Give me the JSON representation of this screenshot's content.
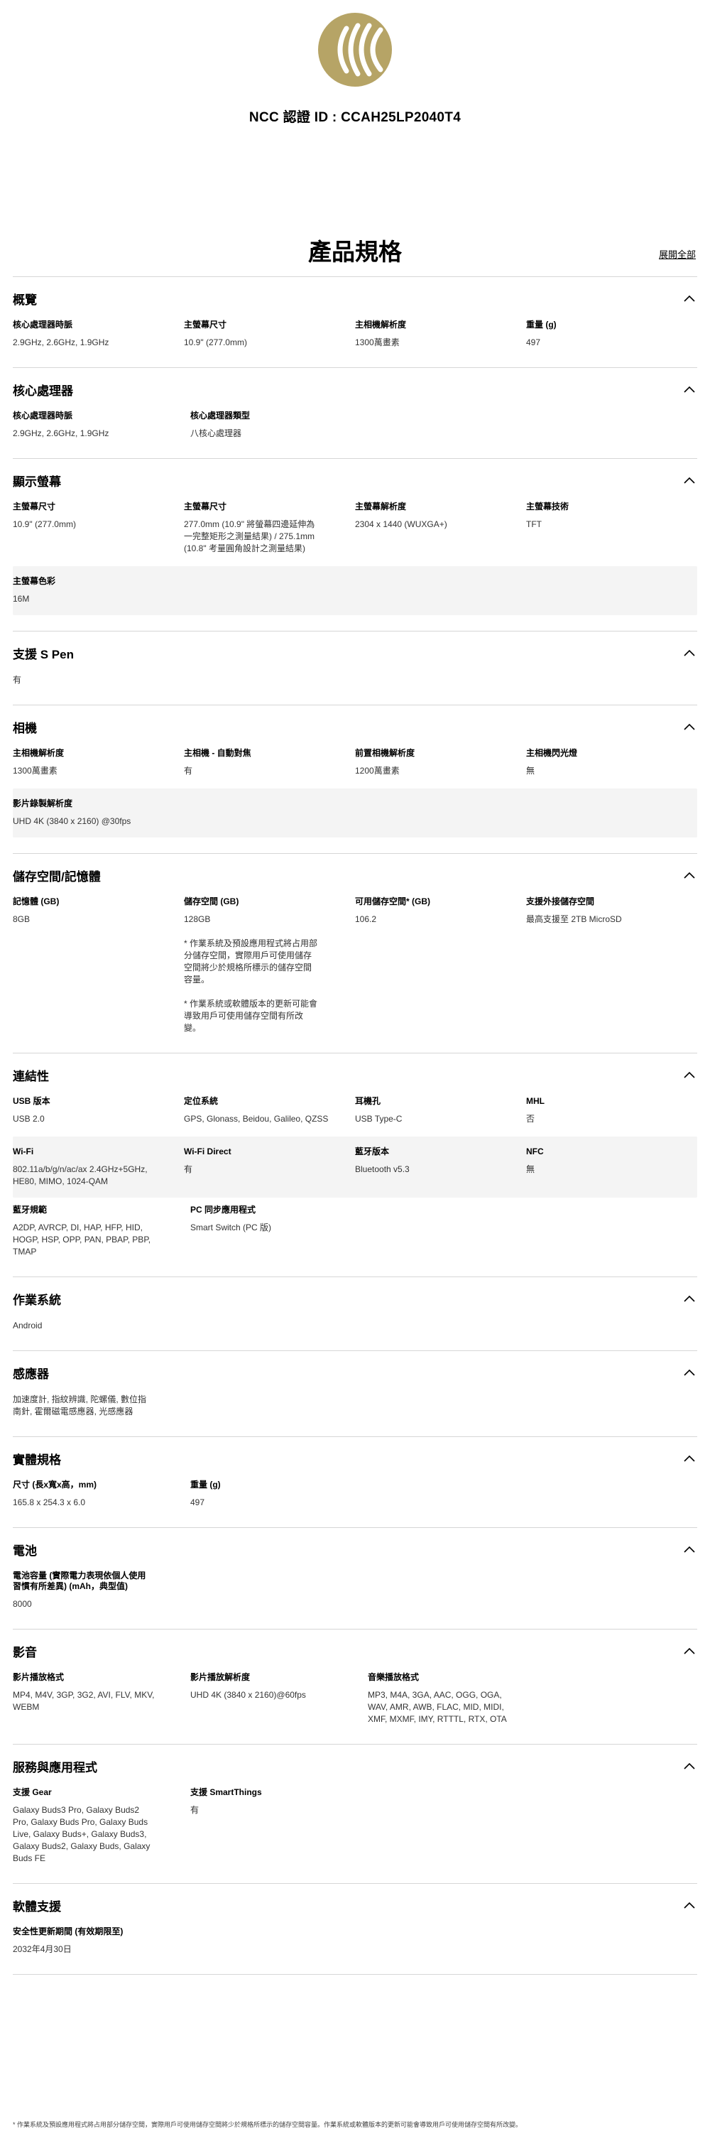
{
  "ncc": {
    "text": "NCC 認證 ID : CCAH25LP2040T4",
    "logo_color": "#B6A466"
  },
  "header": {
    "title": "產品規格",
    "expand_all": "展開全部"
  },
  "sections": [
    {
      "title": "概覽",
      "rows": [
        {
          "shaded": false,
          "cells": [
            {
              "label": "核心處理器時脈",
              "value": "2.9GHz, 2.6GHz, 1.9GHz"
            },
            {
              "label": "主螢幕尺寸",
              "value": "10.9\" (277.0mm)"
            },
            {
              "label": "主相機解析度",
              "value": "1300萬畫素"
            },
            {
              "label": "重量 (g)",
              "value": "497"
            }
          ]
        }
      ]
    },
    {
      "title": "核心處理器",
      "rows": [
        {
          "shaded": false,
          "cells": [
            {
              "label": "核心處理器時脈",
              "value": "2.9GHz, 2.6GHz, 1.9GHz"
            },
            {
              "label": "核心處理器類型",
              "value": "八核心處理器"
            }
          ]
        }
      ]
    },
    {
      "title": "顯示螢幕",
      "rows": [
        {
          "shaded": false,
          "cells": [
            {
              "label": "主螢幕尺寸",
              "value": "10.9\" (277.0mm)"
            },
            {
              "label": "主螢幕尺寸",
              "value": "277.0mm (10.9\" 將螢幕四邊延伸為\n一完整矩形之測量結果) / 275.1mm\n(10.8\" 考量圓角設計之測量結果)"
            },
            {
              "label": "主螢幕解析度",
              "value": "2304 x 1440 (WUXGA+)"
            },
            {
              "label": "主螢幕技術",
              "value": "TFT"
            }
          ]
        },
        {
          "shaded": true,
          "cells": [
            {
              "label": "主螢幕色彩",
              "value": "16M"
            }
          ]
        }
      ]
    },
    {
      "title": "支援 S Pen",
      "rows": [
        {
          "shaded": false,
          "cells": [
            {
              "label": "",
              "value": "有"
            }
          ]
        }
      ]
    },
    {
      "title": "相機",
      "rows": [
        {
          "shaded": false,
          "cells": [
            {
              "label": "主相機解析度",
              "value": "1300萬畫素"
            },
            {
              "label": "主相機 - 自動對焦",
              "value": "有"
            },
            {
              "label": "前置相機解析度",
              "value": "1200萬畫素"
            },
            {
              "label": "主相機閃光燈",
              "value": "無"
            }
          ]
        },
        {
          "shaded": true,
          "cells": [
            {
              "label": "影片錄製解析度",
              "value": "UHD 4K (3840 x 2160) @30fps"
            }
          ]
        }
      ]
    },
    {
      "title": "儲存空間/記憶體",
      "rows": [
        {
          "shaded": false,
          "cells": [
            {
              "label": "記憶體 (GB)",
              "value": "8GB"
            },
            {
              "label": "儲存空間 (GB)",
              "value": "128GB\n\n* 作業系統及預設應用程式將占用部\n分儲存空間，實際用戶可使用儲存\n空間將少於規格所標示的儲存空間\n容量。\n\n* 作業系統或軟體版本的更新可能會\n導致用戶可使用儲存空間有所改\n變。"
            },
            {
              "label": "可用儲存空間* (GB)",
              "value": "106.2"
            },
            {
              "label": "支援外接儲存空間",
              "value": "最高支援至 2TB MicroSD"
            }
          ]
        }
      ]
    },
    {
      "title": "連結性",
      "rows": [
        {
          "shaded": false,
          "cells": [
            {
              "label": "USB 版本",
              "value": "USB 2.0"
            },
            {
              "label": "定位系統",
              "value": "GPS, Glonass, Beidou, Galileo, QZSS"
            },
            {
              "label": "耳機孔",
              "value": "USB Type-C"
            },
            {
              "label": "MHL",
              "value": "否"
            }
          ]
        },
        {
          "shaded": true,
          "cells": [
            {
              "label": "Wi-Fi",
              "value": "802.11a/b/g/n/ac/ax 2.4GHz+5GHz,\nHE80, MIMO, 1024-QAM"
            },
            {
              "label": "Wi-Fi Direct",
              "value": "有"
            },
            {
              "label": "藍牙版本",
              "value": "Bluetooth v5.3"
            },
            {
              "label": "NFC",
              "value": "無"
            }
          ]
        },
        {
          "shaded": false,
          "cells": [
            {
              "label": "藍牙規範",
              "value": "A2DP, AVRCP, DI, HAP, HFP, HID,\nHOGP, HSP, OPP, PAN, PBAP, PBP,\nTMAP"
            },
            {
              "label": "PC 同步應用程式",
              "value": "Smart Switch (PC 版)"
            }
          ]
        }
      ]
    },
    {
      "title": "作業系統",
      "rows": [
        {
          "shaded": false,
          "cells": [
            {
              "label": "",
              "value": "Android"
            }
          ]
        }
      ]
    },
    {
      "title": "感應器",
      "rows": [
        {
          "shaded": false,
          "cells": [
            {
              "label": "",
              "value": "加速度計, 指紋辨識, 陀螺儀, 數位指\n南針, 霍爾磁電感應器, 光感應器"
            }
          ]
        }
      ]
    },
    {
      "title": "實體規格",
      "rows": [
        {
          "shaded": false,
          "cells": [
            {
              "label": "尺寸 (長x寬x高，mm)",
              "value": "165.8 x 254.3 x 6.0"
            },
            {
              "label": "重量 (g)",
              "value": "497"
            }
          ]
        }
      ]
    },
    {
      "title": "電池",
      "rows": [
        {
          "shaded": false,
          "cells": [
            {
              "label": "電池容量 (實際電力表現依個人使用\n習慣有所差異) (mAh，典型值)",
              "value": "8000"
            }
          ]
        }
      ]
    },
    {
      "title": "影音",
      "rows": [
        {
          "shaded": false,
          "cells": [
            {
              "label": "影片播放格式",
              "value": "MP4, M4V, 3GP, 3G2, AVI, FLV, MKV,\nWEBM"
            },
            {
              "label": "影片播放解析度",
              "value": "UHD 4K (3840 x 2160)@60fps"
            },
            {
              "label": "音樂播放格式",
              "value": "MP3, M4A, 3GA, AAC, OGG, OGA,\nWAV, AMR, AWB, FLAC, MID, MIDI,\nXMF, MXMF, IMY, RTTTL, RTX, OTA"
            }
          ]
        }
      ]
    },
    {
      "title": "服務與應用程式",
      "rows": [
        {
          "shaded": false,
          "cells": [
            {
              "label": "支援 Gear",
              "value": "Galaxy Buds3 Pro, Galaxy Buds2\nPro, Galaxy Buds Pro, Galaxy Buds\nLive, Galaxy Buds+, Galaxy Buds3,\nGalaxy Buds2, Galaxy Buds, Galaxy\nBuds FE"
            },
            {
              "label": "支援 SmartThings",
              "value": "有"
            }
          ]
        }
      ]
    },
    {
      "title": "軟體支援",
      "rows": [
        {
          "shaded": false,
          "cells": [
            {
              "label": "安全性更新期間 (有效期限至)",
              "value": "2032年4月30日"
            }
          ]
        }
      ]
    }
  ],
  "footnote": "* 作業系統及預設應用程式將占用部分儲存空間，實際用戶可使用儲存空間將少於規格所標示的儲存空間容量。作業系統或軟體版本的更新可能會導致用戶可使用儲存空間有所改變。"
}
